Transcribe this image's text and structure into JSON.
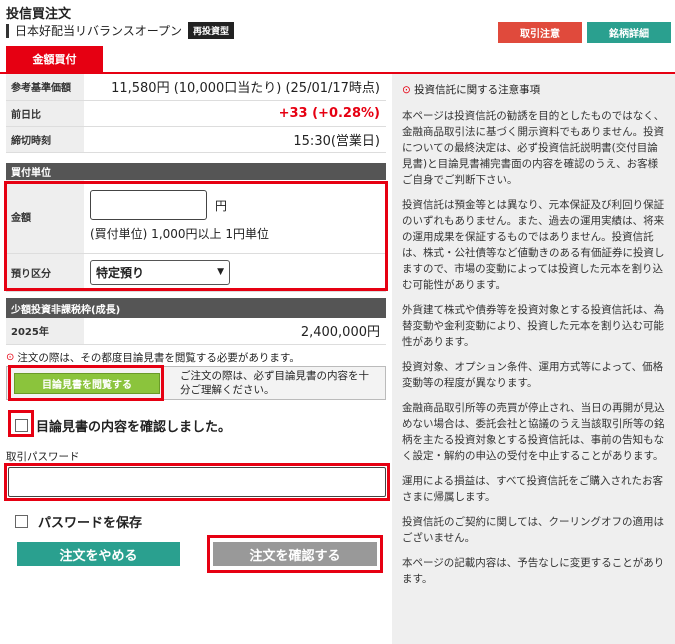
{
  "header": {
    "title": "投信買注文",
    "fund_name": "日本好配当リバランスオープン",
    "reinvest_badge": "再投資型",
    "caution_button": "取引注意",
    "details_button": "銘柄詳細"
  },
  "tabs": [
    {
      "label": "金額買付"
    }
  ],
  "info": {
    "rows": [
      {
        "label": "参考基準価額",
        "value": "11,580円 (10,000口当たり) (25/01/17時点)"
      },
      {
        "label": "前日比",
        "value": "+33 (+0.28%)"
      },
      {
        "label": "締切時刻",
        "value": "15:30(営業日)"
      }
    ]
  },
  "order": {
    "section_title": "買付単位",
    "amount_label": "金額",
    "amount_value": "",
    "amount_unit": "円",
    "amount_note": "(買付単位) 1,000円以上 1円単位",
    "deposit_label": "預り区分",
    "deposit_selected": "特定預り"
  },
  "nisa": {
    "section_title": "少額投資非課税枠(成長)",
    "year": "2025年",
    "amount": "2,400,000円"
  },
  "prospectus": {
    "notice": "注文の際は、その都度目論見書を閲覧する必要があります。",
    "view_button": "目論見書を閲覧する",
    "box_text": "ご注文の際は、必ず目論見書の内容を十分ご理解ください。",
    "confirm_label": "目論見書の内容を確認しました。"
  },
  "password": {
    "label": "取引パスワード",
    "value": "",
    "save_label": "パスワードを保存"
  },
  "actions": {
    "cancel": "注文をやめる",
    "confirm": "注文を確認する"
  },
  "notes": {
    "heading": "投資信託に関する注意事項",
    "paragraphs": [
      "本ページは投資信託の勧誘を目的としたものではなく、金融商品取引法に基づく開示資料でもありません。投資についての最終決定は、必ず投資信託説明書(交付目論見書)と目論見書補完書面の内容を確認のうえ、お客様ご自身でご判断下さい。",
      "投資信託は預金等とは異なり、元本保証及び利回り保証のいずれもありません。また、過去の運用実績は、将来の運用成果を保証するものではありません。投資信託は、株式・公社債等など値動きのある有価証券に投資しますので、市場の変動によっては投資した元本を割り込む可能性があります。",
      "外貨建て株式や債券等を投資対象とする投資信託は、為替変動や金利変動により、投資した元本を割り込む可能性があります。",
      "投資対象、オプション条件、運用方式等によって、価格変動等の程度が異なります。",
      "金融商品取引所等の売買が停止され、当日の再開が見込めない場合は、委託会社と協議のうえ当該取引所等の銘柄を主たる投資対象とする投資信託は、事前の告知もなく設定・解約の申込の受付を中止することがあります。",
      "運用による損益は、すべて投資信託をご購入されたお客さまに帰属します。",
      "投資信託のご契約に関しては、クーリングオフの適用はございません。",
      "本ページの記載内容は、予告なしに変更することがあります。"
    ]
  }
}
